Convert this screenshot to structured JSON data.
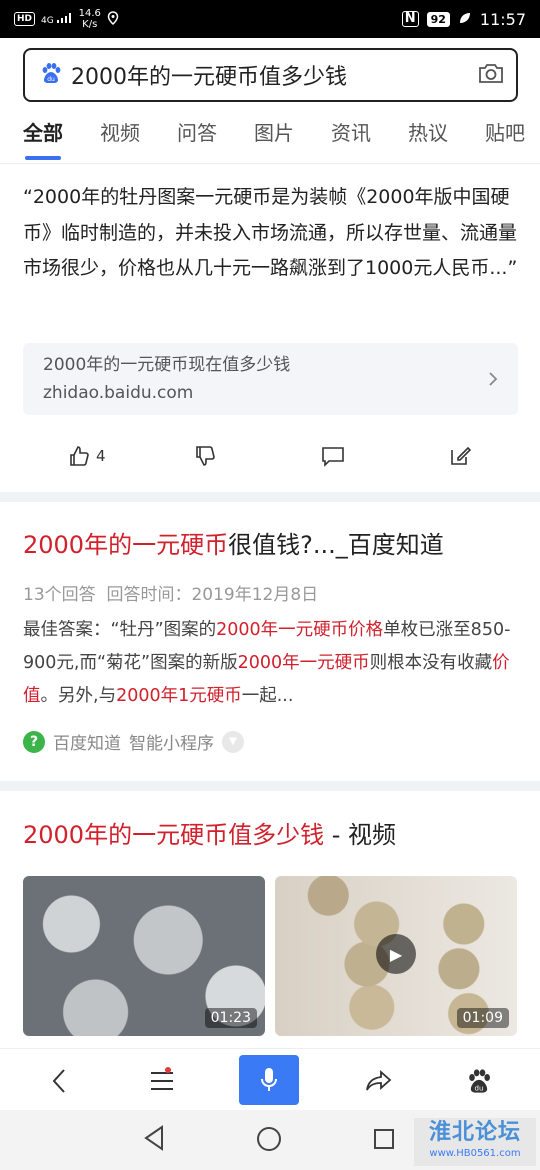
{
  "status_bar": {
    "hd": "HD",
    "signal": "4G",
    "speed_value": "14.6",
    "speed_unit": "K/s",
    "nfc": "N",
    "battery": "92",
    "time": "11:57"
  },
  "search": {
    "query": "2000年的一元硬币值多少钱",
    "camera_icon": "camera-icon",
    "logo_icon": "baidu-paw-icon"
  },
  "tabs": [
    "全部",
    "视频",
    "问答",
    "图片",
    "资讯",
    "热议",
    "贴吧"
  ],
  "answer_card": {
    "text": "“2000年的牡丹图案一元硬币是为装帧《2000年版中国硬币》临时制造的，并未投入市场流通，所以存世量、流通量市场很少，价格也从几十元一路飙涨到了1000元人民币...”",
    "source_title": "2000年的一元硬币现在值多少钱",
    "source_url": "zhidao.baidu.com",
    "like_count": "4"
  },
  "result2": {
    "title_red": "2000年的一元硬币",
    "title_rest": "很值钱?..._百度知道",
    "meta_count": "13个回答",
    "meta_time": "回答时间：2019年12月8日",
    "snippet": [
      {
        "t": "最佳答案：“牡丹”图案的",
        "hl": false
      },
      {
        "t": "2000年一元硬币价格",
        "hl": true
      },
      {
        "t": "单枚已涨至850-900元,而“菊花”图案的新版",
        "hl": false
      },
      {
        "t": "2000年一元硬币",
        "hl": true
      },
      {
        "t": "则根本没有收藏",
        "hl": false
      },
      {
        "t": "价值",
        "hl": true
      },
      {
        "t": "。另外,与",
        "hl": false
      },
      {
        "t": "2000年1元硬币",
        "hl": true
      },
      {
        "t": "一起...",
        "hl": false
      }
    ],
    "source_name": "百度知道",
    "source_tag": "智能小程序"
  },
  "result3": {
    "title_red": "2000年的一元硬币值多少钱",
    "title_rest": " - 视频",
    "videos": [
      {
        "duration": "01:23"
      },
      {
        "duration": "01:09"
      }
    ]
  },
  "watermark": {
    "title": "淮北论坛",
    "url": "www.HB0561.com"
  },
  "colors": {
    "accent": "#3a6ff0",
    "highlight": "#d0212c",
    "mic": "#3a7bf5"
  }
}
